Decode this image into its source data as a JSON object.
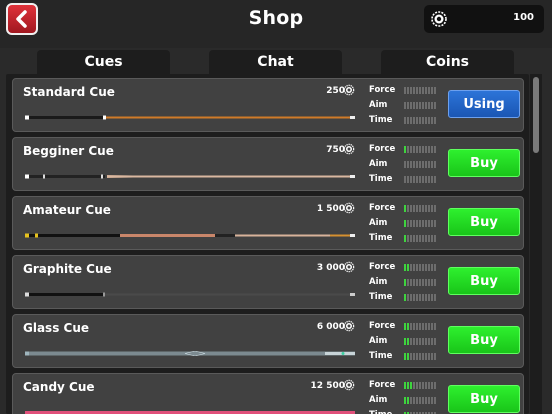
{
  "header": {
    "title": "Shop",
    "coins": "100"
  },
  "tabs": [
    {
      "label": "Cues"
    },
    {
      "label": "Chat"
    },
    {
      "label": "Coins"
    }
  ],
  "stat_labels": {
    "force": "Force",
    "aim": "Aim",
    "time": "Time"
  },
  "cues": [
    {
      "name": "Standard Cue",
      "price": "250",
      "force": 0,
      "aim": 0,
      "time": 0,
      "action": "Using",
      "state": "using",
      "style": "standard"
    },
    {
      "name": "Begginer Cue",
      "price": "750",
      "force": 1,
      "aim": 0,
      "time": 0,
      "action": "Buy",
      "state": "buy",
      "style": "beginner"
    },
    {
      "name": "Amateur Cue",
      "price": "1 500",
      "force": 1,
      "aim": 1,
      "time": 1,
      "action": "Buy",
      "state": "buy",
      "style": "amateur"
    },
    {
      "name": "Graphite Cue",
      "price": "3 000",
      "force": 2,
      "aim": 1,
      "time": 1,
      "action": "Buy",
      "state": "buy",
      "style": "graphite"
    },
    {
      "name": "Glass Cue",
      "price": "6 000",
      "force": 2,
      "aim": 2,
      "time": 2,
      "action": "Buy",
      "state": "buy",
      "style": "glass"
    },
    {
      "name": "Candy Cue",
      "price": "12 500",
      "force": 3,
      "aim": 2,
      "time": 2,
      "action": "Buy",
      "state": "buy",
      "style": "candy"
    }
  ],
  "colors": {
    "buy": "#22dd22",
    "using": "#1f63c6",
    "stat_on": "#3ed43e",
    "stat_off": "#6d6d6d",
    "back": "#c8242c"
  },
  "icons": {
    "back": "chevron-left-icon",
    "coin": "coin-icon"
  }
}
